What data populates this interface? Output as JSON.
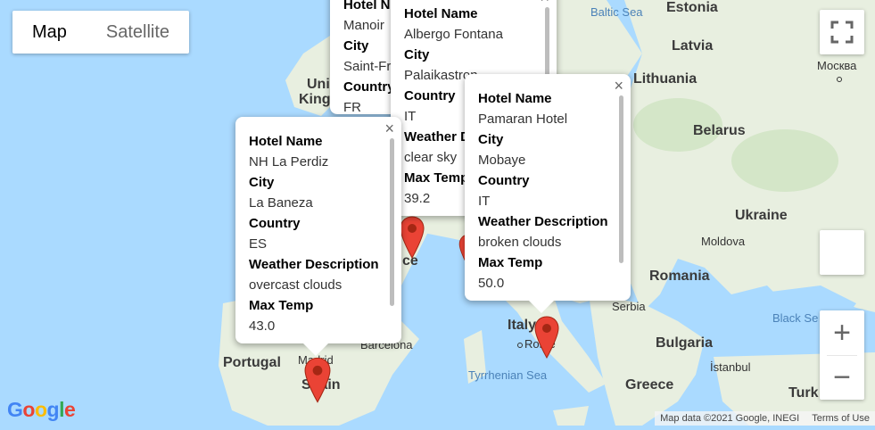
{
  "map_type": {
    "map_label": "Map",
    "satellite_label": "Satellite",
    "active": "Map"
  },
  "labels": {
    "baltic_sea": "Baltic Sea",
    "estonia": "Estonia",
    "latvia": "Latvia",
    "moscow": "Москва",
    "lithuania": "Lithuania",
    "belarus": "Belarus",
    "ukraine": "Ukraine",
    "moldova": "Moldova",
    "romania": "Romania",
    "serbia": "Serbia",
    "black_sea": "Black Se",
    "bulgaria": "Bulgaria",
    "istanbul": "İstanbul",
    "greece": "Greece",
    "turkey": "Turk",
    "italy": "Italy",
    "rome": "Rome",
    "tyrrhenian_sea": "Tyrrhenian Sea",
    "portugal": "Portugal",
    "barcelona": "Barcelona",
    "madrid": "Madrid",
    "spain": "Spain",
    "uk_fragment_1": "Uni",
    "uk_fragment_2": "King",
    "france_fragment": "ce"
  },
  "info_windows": [
    {
      "id": "manoir",
      "fields": [
        {
          "label": "Hotel N",
          "value": "Manoir"
        },
        {
          "label": "City",
          "value": "Saint-Fr"
        },
        {
          "label": "Country",
          "value": "FR"
        }
      ]
    },
    {
      "id": "fontana",
      "fields": [
        {
          "label": "Hotel Name",
          "value": "Albergo Fontana"
        },
        {
          "label": "City",
          "value": "Palaikastron"
        },
        {
          "label": "Country",
          "value": "IT"
        },
        {
          "label": "Weather D",
          "value": "clear sky"
        },
        {
          "label": "Max Temp",
          "value": "39.2"
        }
      ]
    },
    {
      "id": "pamaran",
      "fields": [
        {
          "label": "Hotel Name",
          "value": "Pamaran Hotel"
        },
        {
          "label": "City",
          "value": "Mobaye"
        },
        {
          "label": "Country",
          "value": "IT"
        },
        {
          "label": "Weather Description",
          "value": "broken clouds"
        },
        {
          "label": "Max Temp",
          "value": "50.0"
        }
      ]
    },
    {
      "id": "perdiz",
      "fields": [
        {
          "label": "Hotel Name",
          "value": "NH La Perdiz"
        },
        {
          "label": "City",
          "value": "La Baneza"
        },
        {
          "label": "Country",
          "value": "ES"
        },
        {
          "label": "Weather Description",
          "value": "overcast clouds"
        },
        {
          "label": "Max Temp",
          "value": "43.0"
        }
      ]
    }
  ],
  "close_glyph": "×",
  "attribution": {
    "map_data": "Map data ©2021 Google, INEGI",
    "terms": "Terms of Use"
  },
  "logo": [
    "G",
    "o",
    "o",
    "g",
    "l",
    "e"
  ],
  "colors": {
    "water": "#aadaff",
    "land": "#e8efe0",
    "pin": "#ea4335",
    "pin_dark": "#a52714"
  },
  "icons": {
    "fullscreen": "fullscreen-icon",
    "pegman": "pegman-icon",
    "zoom_in": "+",
    "zoom_out": "−"
  }
}
